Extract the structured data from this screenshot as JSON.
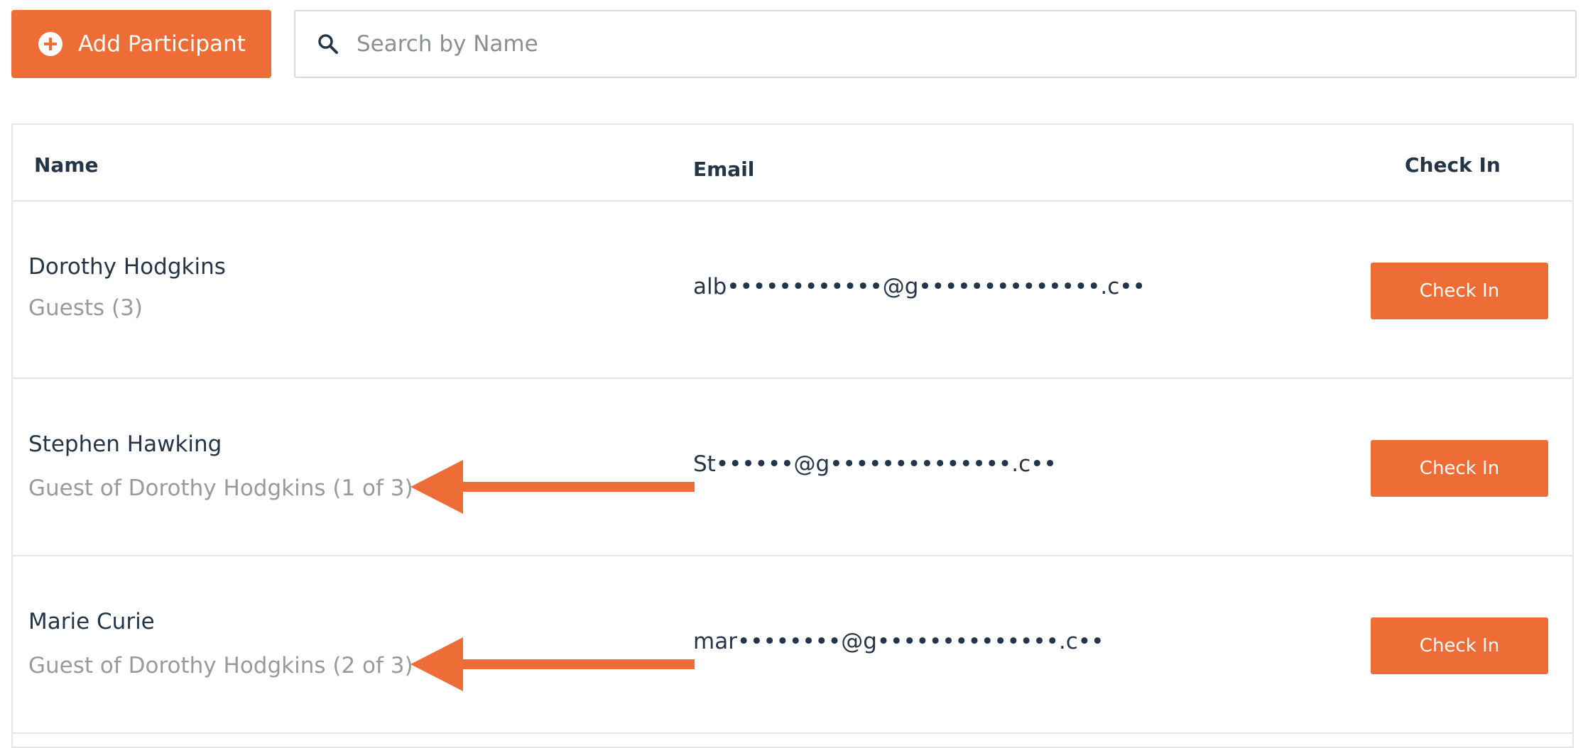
{
  "toolbar": {
    "add_label": "Add Participant",
    "search_placeholder": "Search by Name"
  },
  "table": {
    "headers": {
      "name": "Name",
      "email": "Email",
      "check_in": "Check In"
    },
    "rows": [
      {
        "name": "Dorothy Hodgkins",
        "sub": "Guests (3)",
        "email": "alb••••••••••••@g••••••••••••••.c••",
        "button": "Check In"
      },
      {
        "name": "Stephen Hawking",
        "sub": "Guest of Dorothy Hodgkins (1 of 3)",
        "email": "St••••••@g••••••••••••••.c••",
        "button": "Check In"
      },
      {
        "name": "Marie Curie",
        "sub": "Guest of Dorothy Hodgkins (2 of 3)",
        "email": "mar••••••••@g••••••••••••••.c••",
        "button": "Check In"
      }
    ]
  },
  "colors": {
    "accent": "#ee6c35",
    "text": "#253548",
    "muted": "#9a9a9a",
    "border": "#e6e6e6"
  },
  "icons": {
    "add": "plus-circle-icon",
    "search": "search-icon",
    "annotation": "arrow-left-icon"
  }
}
